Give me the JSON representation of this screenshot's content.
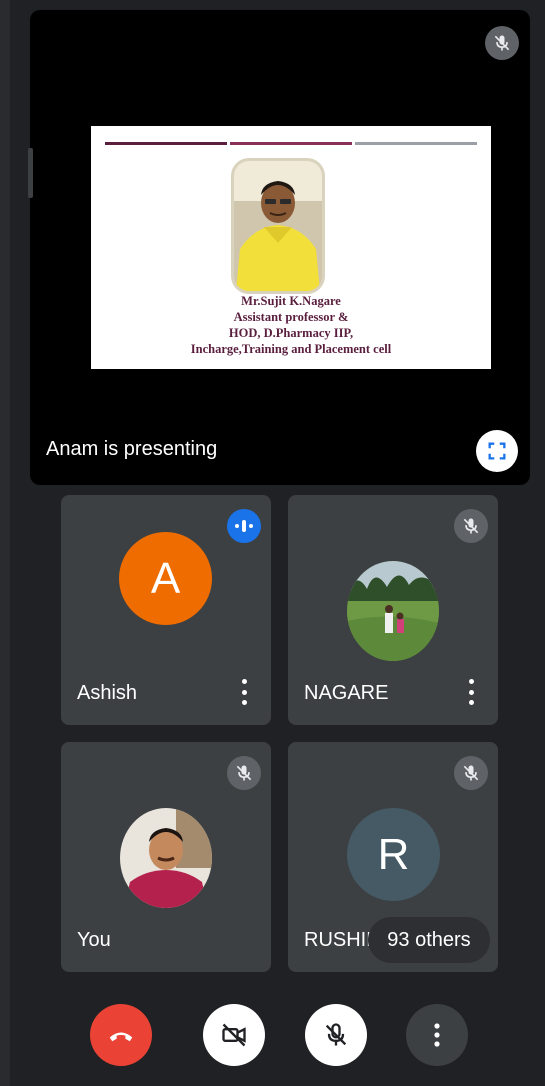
{
  "presentation": {
    "presenter_label": "Anam is presenting",
    "slide": {
      "name": "Mr.Sujit K.Nagare",
      "line2": "Assistant professor &",
      "line3": "HOD, D.Pharmacy IIP,",
      "line4": "Incharge,Training and Placement cell"
    },
    "muted": true
  },
  "participants": [
    {
      "name": "Ashish",
      "initial": "A",
      "avatar_color": "#ef6c00",
      "speaking": true
    },
    {
      "name": "NAGARE",
      "initial": "",
      "avatar": "landscape-photo",
      "muted": true
    },
    {
      "name": "You",
      "initial": "",
      "avatar": "profile-photo",
      "muted": true
    },
    {
      "name": "RUSHIKESH",
      "initial": "R",
      "avatar_color": "#455a64",
      "muted": true
    }
  ],
  "others_badge": "93 others",
  "controls": {
    "end_call": {
      "icon": "phone-hangup-icon",
      "color": "#ea4335"
    },
    "camera": {
      "icon": "video-off-icon",
      "color": "#ffffff"
    },
    "mic": {
      "icon": "mic-off-icon",
      "color": "#ffffff"
    },
    "more": {
      "icon": "more-vert-icon",
      "color": "#3c4043"
    }
  }
}
